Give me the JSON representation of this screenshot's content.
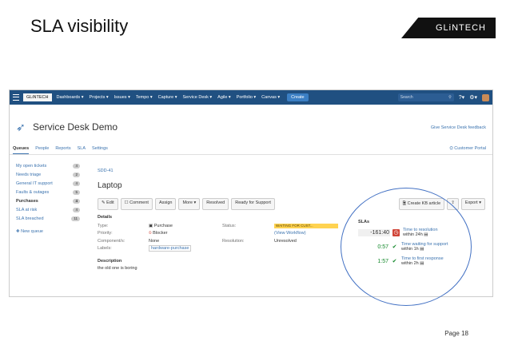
{
  "slide": {
    "title": "SLA visibility",
    "brand": "GLiNTECH",
    "page_label": "Page 18"
  },
  "topnav": {
    "logo": "GLiNTECH",
    "items": [
      "Dashboards ▾",
      "Projects ▾",
      "Issues ▾",
      "Tempo ▾",
      "Capture ▾",
      "Service Desk ▾",
      "Agile ▾",
      "Portfolio ▾",
      "Canvas ▾"
    ],
    "create": "Create",
    "search_placeholder": "Search"
  },
  "project": {
    "title": "Service Desk Demo",
    "feedback": "Give Service Desk feedback"
  },
  "tabs": [
    "Queues",
    "People",
    "Reports",
    "SLA",
    "Settings"
  ],
  "customer_portal": "Customer Portal",
  "queues": [
    {
      "label": "My open tickets",
      "count": "4"
    },
    {
      "label": "Needs triage",
      "count": "2"
    },
    {
      "label": "General IT support",
      "count": "4"
    },
    {
      "label": "Faults & outages",
      "count": "5"
    },
    {
      "label": "Purchases",
      "count": "4"
    },
    {
      "label": "SLA at risk",
      "count": "4"
    },
    {
      "label": "SLA breached",
      "count": "11"
    }
  ],
  "new_queue": "New queue",
  "issue": {
    "key": "SDD-41",
    "title": "Laptop",
    "buttons": [
      "Edit",
      "Comment",
      "Assign",
      "More ▾",
      "Resolved",
      "Ready for Support"
    ],
    "right_buttons": [
      "Create KB article",
      "⇪",
      "Export ▾"
    ],
    "details_heading": "Details",
    "type_label": "Type:",
    "type_value": "Purchase",
    "priority_label": "Priority:",
    "priority_value": "Blocker",
    "component_label": "Component/s:",
    "component_value": "None",
    "labels_label": "Labels:",
    "labels_value": "hardware-purchase",
    "status_label": "Status:",
    "status_value": "WAITING FOR CUST...",
    "view_workflow": "(View Workflow)",
    "resolution_label": "Resolution:",
    "resolution_value": "Unresolved",
    "description_heading": "Description",
    "description": "the old one is boring"
  },
  "slas": {
    "heading": "SLAs",
    "items": [
      {
        "value": "-161:40",
        "status": "breached",
        "title": "Time to resolution",
        "goal": "within 24h"
      },
      {
        "value": "0:57",
        "status": "ok",
        "title": "Time waiting for support",
        "goal": "within 1h"
      },
      {
        "value": "1:57",
        "status": "ok",
        "title": "Time to first response",
        "goal": "within 2h"
      }
    ]
  },
  "colors": {
    "nav": "#205081",
    "link": "#3b73af",
    "breached": "#d04437",
    "ok": "#14892c",
    "callout": "#4472c4"
  }
}
